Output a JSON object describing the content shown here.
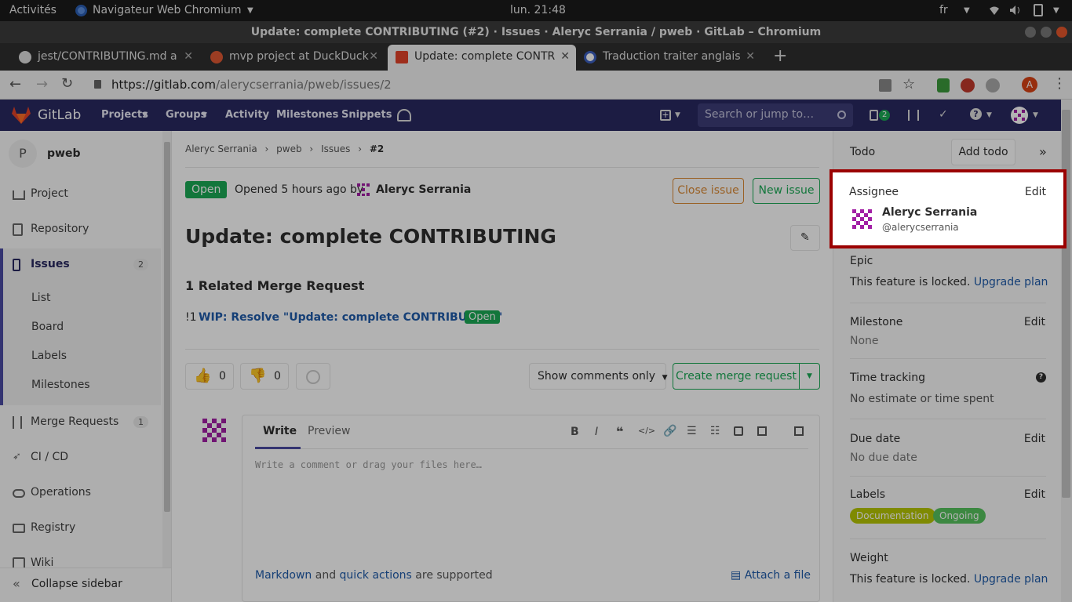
{
  "os": {
    "activities": "Activités",
    "app_menu": "Navigateur Web Chromium",
    "clock": "lun. 21:48",
    "lang": "fr"
  },
  "browser": {
    "window_title": "Update: complete CONTRIBUTING (#2) · Issues · Aleryc Serrania / pweb · GitLab – Chromium",
    "tabs": [
      {
        "label": "jest/CONTRIBUTING.md a",
        "favicon": "github-icon"
      },
      {
        "label": "mvp project at DuckDuck",
        "favicon": "duckduckgo-icon"
      },
      {
        "label": "Update: complete CONTR",
        "favicon": "gitlab-icon"
      },
      {
        "label": "Traduction traiter anglais",
        "favicon": "reverso-icon"
      }
    ],
    "url_host": "https://gitlab.com",
    "url_path": "/alerycserrania/pweb/issues/2",
    "profile_initial": "A"
  },
  "gitlab_nav": {
    "brand": "GitLab",
    "items": [
      "Projects",
      "Groups",
      "Activity",
      "Milestones",
      "Snippets"
    ],
    "search_placeholder": "Search or jump to…",
    "issues_badge": "2"
  },
  "sidebar": {
    "project_initial": "P",
    "project_name": "pweb",
    "items": [
      {
        "label": "Project",
        "icon": "home-icon"
      },
      {
        "label": "Repository",
        "icon": "doc-icon"
      },
      {
        "label": "Issues",
        "icon": "issues-icon",
        "count": "2"
      },
      {
        "label": "Merge Requests",
        "icon": "merge-icon",
        "count": "1"
      },
      {
        "label": "CI / CD",
        "icon": "rocket-icon"
      },
      {
        "label": "Operations",
        "icon": "cloud-icon"
      },
      {
        "label": "Registry",
        "icon": "box-icon"
      },
      {
        "label": "Wiki",
        "icon": "book-icon"
      }
    ],
    "issue_subitems": [
      "List",
      "Board",
      "Labels",
      "Milestones"
    ],
    "collapse": "Collapse sidebar"
  },
  "issue": {
    "breadcrumb": [
      "Aleryc Serrania",
      "pweb",
      "Issues",
      "#2"
    ],
    "status": "Open",
    "opened_text": "Opened 5 hours ago by",
    "author": "Aleryc Serrania",
    "close_label": "Close issue",
    "new_label": "New issue",
    "title": "Update: complete CONTRIBUTING",
    "related_heading": "1 Related Merge Request",
    "mr_ref": "!1",
    "mr_title": "WIP: Resolve \"Update: complete CONTRIBUTING\"",
    "mr_status": "Open",
    "thumbs_up": "0",
    "thumbs_down": "0",
    "filter_label": "Show comments only",
    "create_mr_label": "Create merge request",
    "write_tab": "Write",
    "preview_tab": "Preview",
    "comment_placeholder": "Write a comment or drag your files here…",
    "md_link": "Markdown",
    "md_and": "and",
    "qa_link": "quick actions",
    "md_supported": "are supported",
    "attach": "Attach a file"
  },
  "right_sidebar": {
    "todo": "Todo",
    "add_todo": "Add todo",
    "assignee_label": "Assignee",
    "assignee_name": "Aleryc Serrania",
    "assignee_handle": "@alerycserrania",
    "edit": "Edit",
    "epic_label": "Epic",
    "locked_text": "This feature is locked.",
    "upgrade": "Upgrade plan",
    "milestone_label": "Milestone",
    "milestone_value": "None",
    "time_label": "Time tracking",
    "time_value": "No estimate or time spent",
    "due_label": "Due date",
    "due_value": "No due date",
    "labels_label": "Labels",
    "labels": [
      {
        "name": "Documentation",
        "color": "#b7c603"
      },
      {
        "name": "Ongoing",
        "color": "#57c35d"
      }
    ],
    "weight_label": "Weight"
  },
  "colors": {
    "gitlab_nav": "#292961",
    "open_green": "#1aaa55",
    "close_orange": "#db8a34",
    "highlight": "#9b0000"
  }
}
